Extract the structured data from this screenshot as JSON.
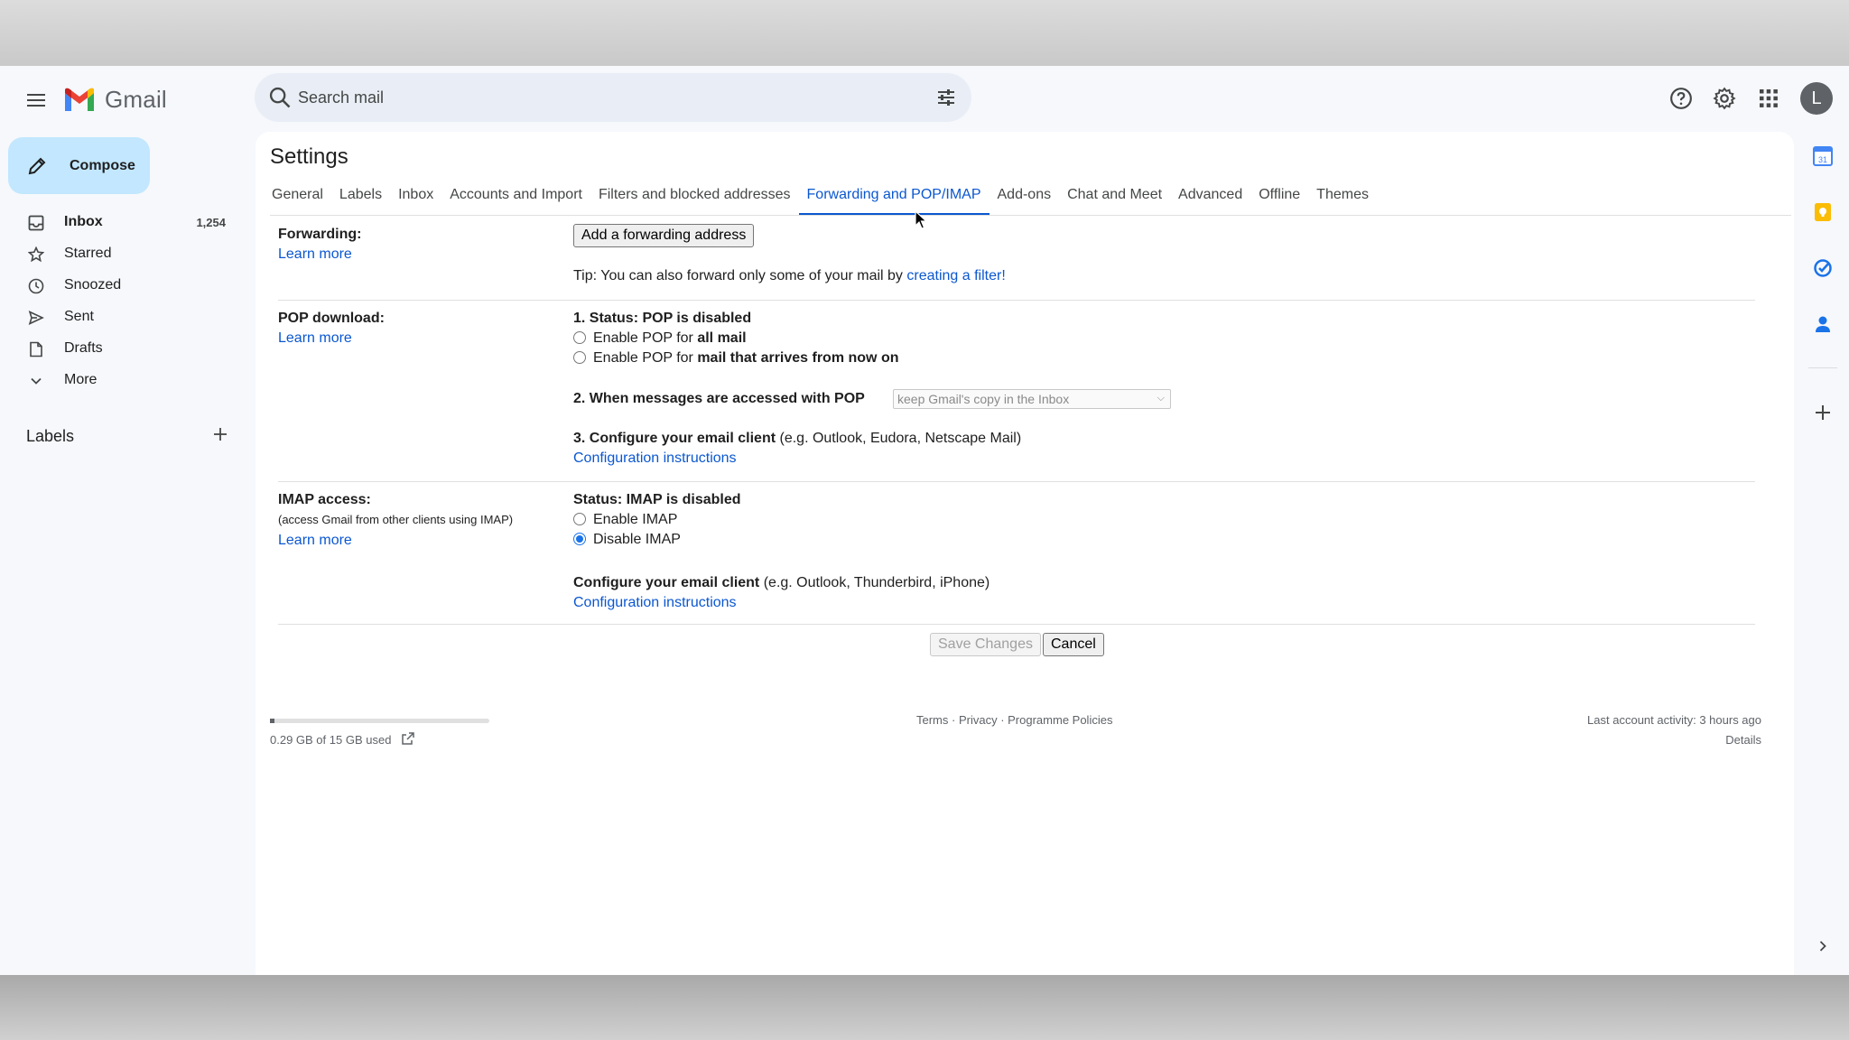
{
  "header": {
    "app_name": "Gmail",
    "search_placeholder": "Search mail",
    "avatar_letter": "L"
  },
  "compose": {
    "label": "Compose"
  },
  "sidebar": {
    "items": [
      {
        "label": "Inbox",
        "count": "1,254",
        "icon": "inbox-icon"
      },
      {
        "label": "Starred",
        "count": "",
        "icon": "star-icon"
      },
      {
        "label": "Snoozed",
        "count": "",
        "icon": "clock-icon"
      },
      {
        "label": "Sent",
        "count": "",
        "icon": "send-icon"
      },
      {
        "label": "Drafts",
        "count": "",
        "icon": "draft-icon"
      },
      {
        "label": "More",
        "count": "",
        "icon": "chevron-down-icon"
      }
    ],
    "labels_heading": "Labels"
  },
  "settings": {
    "title": "Settings",
    "tabs": [
      "General",
      "Labels",
      "Inbox",
      "Accounts and Import",
      "Filters and blocked addresses",
      "Forwarding and POP/IMAP",
      "Add-ons",
      "Chat and Meet",
      "Advanced",
      "Offline",
      "Themes"
    ],
    "active_tab": "Forwarding and POP/IMAP",
    "forwarding": {
      "label": "Forwarding:",
      "learn_more": "Learn more",
      "add_button": "Add a forwarding address",
      "tip_prefix": "Tip: You can also forward only some of your mail by ",
      "tip_link": "creating a filter!"
    },
    "pop": {
      "label": "POP download:",
      "learn_more": "Learn more",
      "status": "1. Status: POP is disabled",
      "opt1_prefix": "Enable POP for ",
      "opt1_bold": "all mail",
      "opt2_prefix": "Enable POP for ",
      "opt2_bold": "mail that arrives from now on",
      "step2": "2. When messages are accessed with POP",
      "step2_select": "keep Gmail's copy in the Inbox",
      "step3_bold": "3. Configure your email client",
      "step3_rest": " (e.g. Outlook, Eudora, Netscape Mail)",
      "config_link": "Configuration instructions"
    },
    "imap": {
      "label": "IMAP access:",
      "sublabel": "(access Gmail from other clients using IMAP)",
      "learn_more": "Learn more",
      "status": "Status: IMAP is disabled",
      "enable": "Enable IMAP",
      "disable": "Disable IMAP",
      "selected": "Disable IMAP",
      "config_bold": "Configure your email client",
      "config_rest": " (e.g. Outlook, Thunderbird, iPhone)",
      "config_link": "Configuration instructions"
    },
    "save_button": "Save Changes",
    "cancel_button": "Cancel"
  },
  "footer": {
    "storage": "0.29 GB of 15 GB used",
    "storage_fraction": 0.019,
    "terms": "Terms",
    "sep1": " · ",
    "privacy": "Privacy",
    "sep2": " · ",
    "policies": "Programme Policies",
    "activity": "Last account activity: 3 hours ago",
    "details": "Details"
  },
  "colors": {
    "accent": "#0b57d0",
    "compose_bg": "#c2e7ff",
    "window_bg": "#f6f8fc"
  }
}
